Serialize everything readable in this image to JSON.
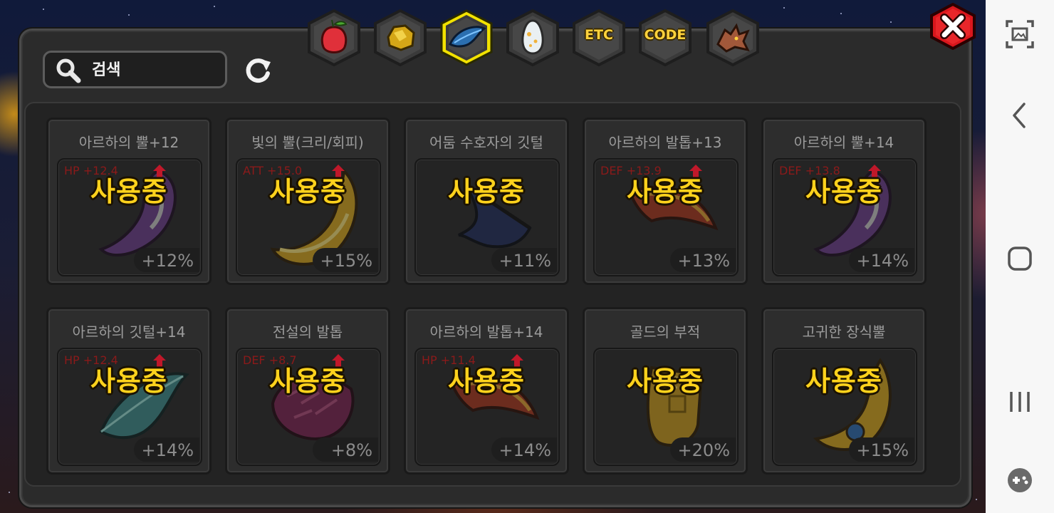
{
  "search": {
    "placeholder": "검색",
    "value": ""
  },
  "tabs": [
    {
      "id": "fruit",
      "label": "",
      "icon": "fruit-icon",
      "selected": false
    },
    {
      "id": "ore",
      "label": "",
      "icon": "gold-ore-icon",
      "selected": false
    },
    {
      "id": "feather",
      "label": "",
      "icon": "blue-feather-icon",
      "selected": true
    },
    {
      "id": "egg",
      "label": "",
      "icon": "egg-icon",
      "selected": false
    },
    {
      "id": "etc",
      "label": "ETC",
      "icon": "etc-icon",
      "selected": false
    },
    {
      "id": "code",
      "label": "CODE",
      "icon": "code-icon",
      "selected": false
    },
    {
      "id": "dragon",
      "label": "",
      "icon": "dragon-head-icon",
      "selected": false
    }
  ],
  "in_use_label": "사용중",
  "items": [
    {
      "name": "아르하의 뿔+12",
      "stat": "HP +12.4",
      "bonus": "+12%",
      "icon": "horn-icon"
    },
    {
      "name": "빛의 뿔(크리/회피)",
      "stat": "ATT +15.0",
      "bonus": "+15%",
      "icon": "golden-horn-icon"
    },
    {
      "name": "어둠 수호자의 깃털",
      "stat": "",
      "bonus": "+11%",
      "icon": "dark-feather-icon"
    },
    {
      "name": "아르하의 발톱+13",
      "stat": "DEF +13.9",
      "bonus": "+13%",
      "icon": "claw-icon"
    },
    {
      "name": "아르하의 뿔+14",
      "stat": "DEF +13.8",
      "bonus": "+14%",
      "icon": "horn-icon"
    },
    {
      "name": "아르하의 깃털+14",
      "stat": "HP +12.4",
      "bonus": "+14%",
      "icon": "feather-icon"
    },
    {
      "name": "전설의 발톱",
      "stat": "DEF +8.7",
      "bonus": "+8%",
      "icon": "scale-claw-icon"
    },
    {
      "name": "아르하의 발톱+14",
      "stat": "HP +11.4",
      "bonus": "+14%",
      "icon": "claw-icon"
    },
    {
      "name": "골드의 부적",
      "stat": "",
      "bonus": "+20%",
      "icon": "gold-charm-icon"
    },
    {
      "name": "고귀한 장식뿔",
      "stat": "",
      "bonus": "+15%",
      "icon": "ornament-horn-icon"
    }
  ],
  "colors": {
    "in_use": "#ffd21c",
    "selected_tab_glow": "#f2e200",
    "close_red": "#d9161c",
    "stat_red": "#8b1a1a"
  },
  "nav_bar": {
    "icons": [
      "screenshot-icon",
      "back-icon",
      "home-icon",
      "recents-icon",
      "game-tools-icon"
    ]
  }
}
